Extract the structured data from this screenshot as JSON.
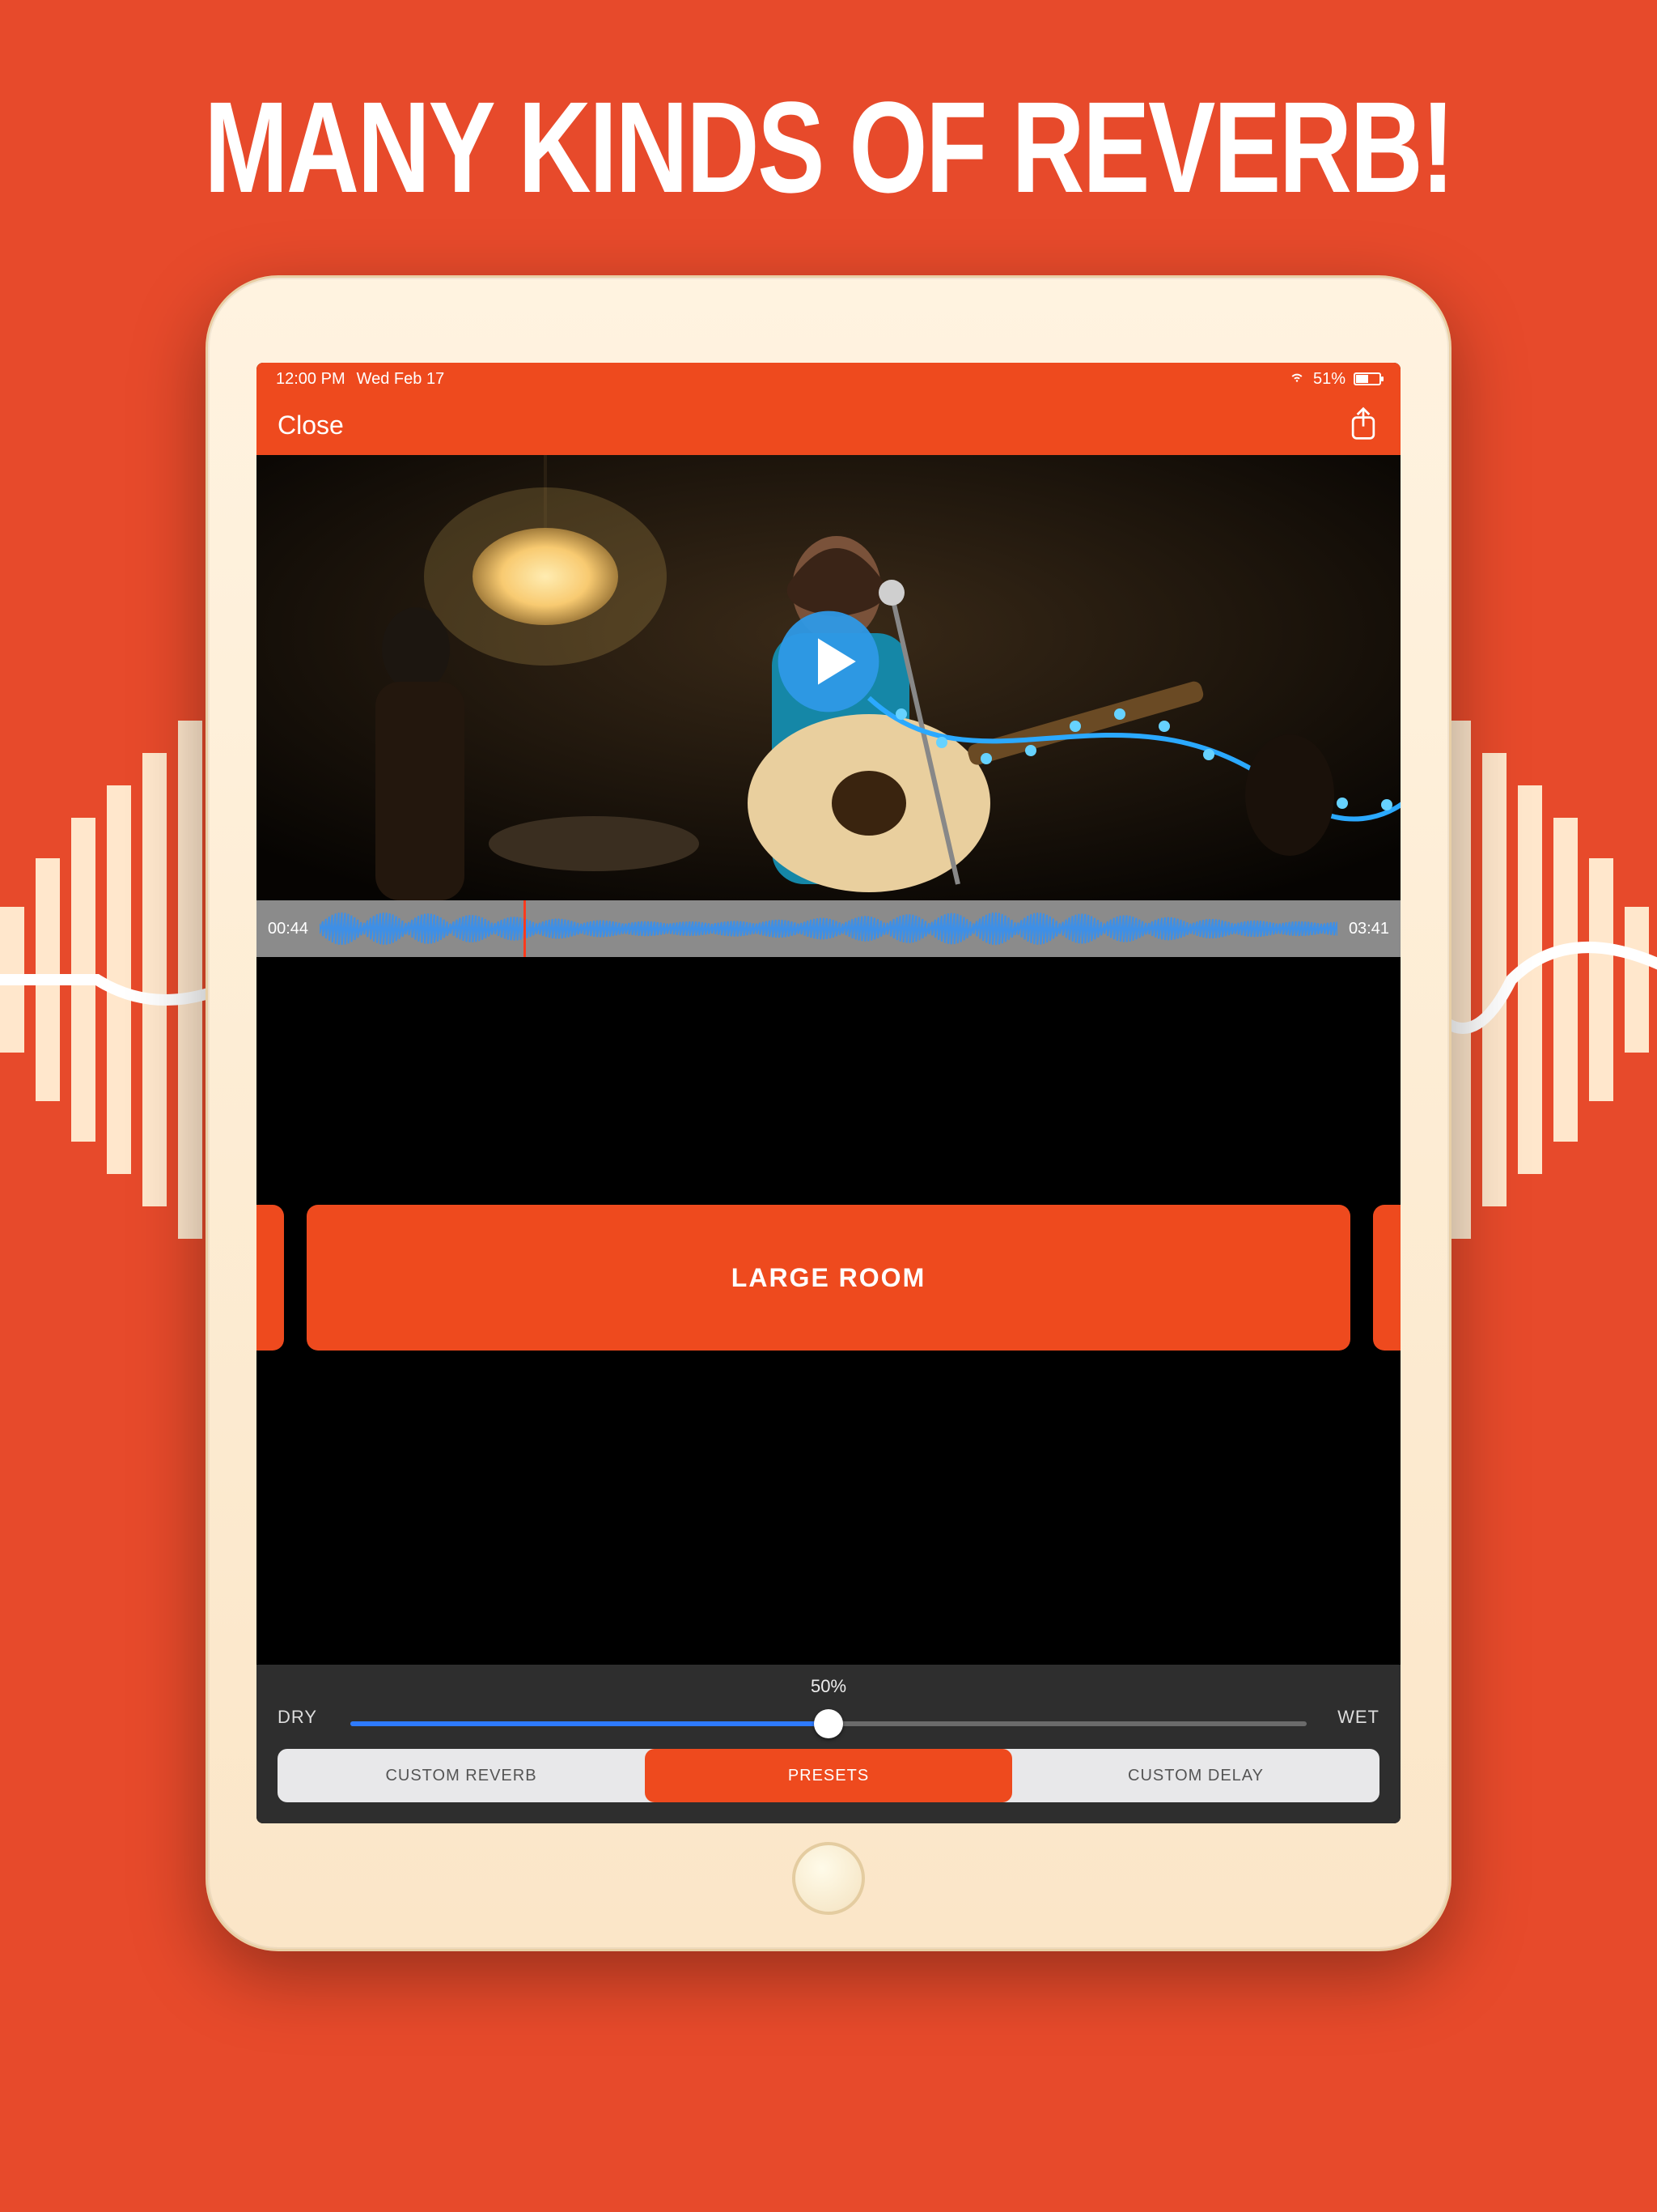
{
  "headline": "MANY KINDS OF REVERB!",
  "statusbar": {
    "time": "12:00 PM",
    "date": "Wed Feb 17",
    "battery_pct_label": "51%",
    "battery_fill_pct": 51
  },
  "navbar": {
    "close_label": "Close"
  },
  "timeline": {
    "current_time": "00:44",
    "total_time": "03:41",
    "playhead_pct": 20
  },
  "preset": {
    "current_label": "LARGE ROOM"
  },
  "slider": {
    "value_label": "50%",
    "value_pct": 50,
    "dry_label": "DRY",
    "wet_label": "WET"
  },
  "segments": {
    "items": [
      {
        "label": "CUSTOM REVERB",
        "active": false
      },
      {
        "label": "PRESETS",
        "active": true
      },
      {
        "label": "CUSTOM DELAY",
        "active": false
      }
    ]
  },
  "colors": {
    "accent": "#EE4A1E",
    "panel": "#2E2E2E",
    "slider_fill": "#2E7BFF"
  }
}
